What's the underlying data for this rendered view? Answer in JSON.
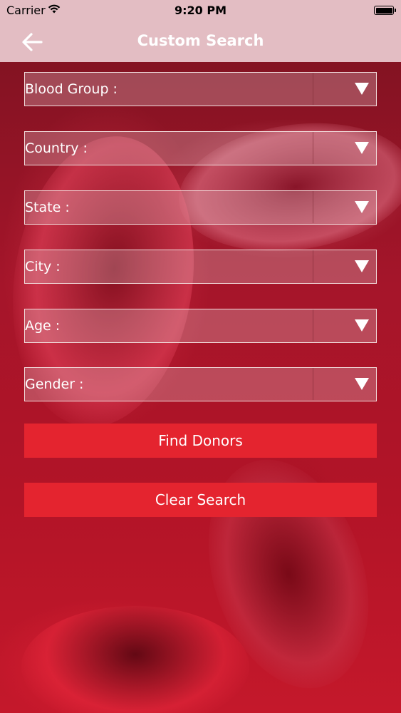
{
  "status_bar": {
    "carrier": "Carrier",
    "time": "9:20 PM"
  },
  "nav": {
    "title": "Custom Search",
    "back_icon": "arrow-left-icon"
  },
  "fields": [
    {
      "label": "Blood Group :"
    },
    {
      "label": "Country :"
    },
    {
      "label": "State :"
    },
    {
      "label": "City :"
    },
    {
      "label": "Age :"
    },
    {
      "label": "Gender :"
    }
  ],
  "buttons": {
    "find": "Find Donors",
    "clear": "Clear Search"
  },
  "colors": {
    "nav_bg": "#e3bdc3",
    "button_bg": "#e4242f",
    "background": "#a5152a"
  }
}
